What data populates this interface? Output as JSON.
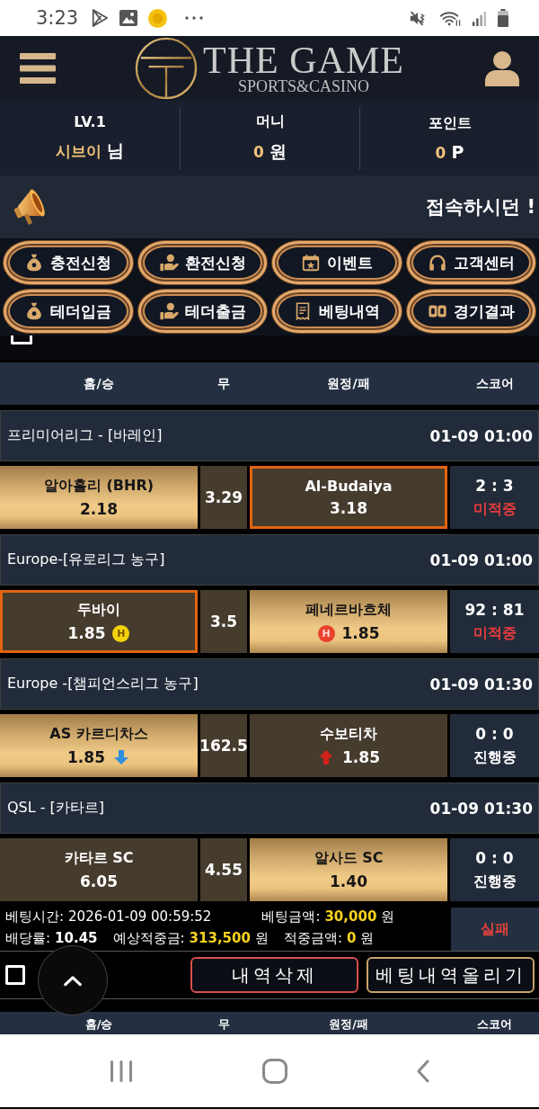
{
  "status_bar": {
    "time": "3:23"
  },
  "header": {
    "brand": "THE GAME",
    "tagline": "SPORTS&CASINO"
  },
  "user_info": [
    {
      "label": "LV.1",
      "value": "시브이",
      "unit": "님"
    },
    {
      "label": "머니",
      "value": "0",
      "unit": "원"
    },
    {
      "label": "포인트",
      "value": "0",
      "unit": "P"
    }
  ],
  "notice": {
    "text": "접속하시던 !"
  },
  "menu": [
    "충전신청",
    "환전신청",
    "이벤트",
    "고객센터",
    "테더입금",
    "테더출금",
    "베팅내역",
    "경기결과"
  ],
  "select_all": {
    "checked": false
  },
  "table": {
    "columns": [
      "홈/승",
      "무",
      "원정/패",
      "스코어"
    ],
    "matches": [
      {
        "league": "프리미어리그 - [바레인]",
        "time": "01-09 01:00",
        "home": {
          "name": "알아흘리 (BHR)",
          "odds": "2.18",
          "selected": true,
          "winner": false
        },
        "draw": "3.29",
        "away": {
          "name": "Al-Budaiya",
          "odds": "3.18",
          "selected": false,
          "winner": true
        },
        "score": "2 : 3",
        "status": {
          "text": "미적중",
          "kind": "miss"
        }
      },
      {
        "league": "Europe-[유로리그 농구]",
        "time": "01-09 01:00",
        "home": {
          "name": "두바이",
          "odds": "1.85",
          "selected": false,
          "winner": true,
          "marker": {
            "kind": "badge",
            "text": "H",
            "color": "#f5d20a"
          }
        },
        "draw": "3.5",
        "away": {
          "name": "페네르바흐체",
          "odds": "1.85",
          "selected": true,
          "winner": false,
          "marker": {
            "kind": "badge",
            "text": "H",
            "color": "#e8412c"
          }
        },
        "score": "92 : 81",
        "status": {
          "text": "미적중",
          "kind": "miss"
        }
      },
      {
        "league": "Europe -[챔피언스리그 농구]",
        "time": "01-09 01:30",
        "home": {
          "name": "AS 카르디차스",
          "odds": "1.85",
          "selected": true,
          "winner": false,
          "marker": {
            "kind": "down"
          }
        },
        "draw": "162.5",
        "away": {
          "name": "수보티차",
          "odds": "1.85",
          "selected": false,
          "winner": false,
          "marker": {
            "kind": "up"
          }
        },
        "score": "0 : 0",
        "status": {
          "text": "진행중",
          "kind": "live"
        }
      },
      {
        "league": "QSL - [카타르]",
        "time": "01-09 01:30",
        "home": {
          "name": "카타르 SC",
          "odds": "6.05",
          "selected": false,
          "winner": false
        },
        "draw": "4.55",
        "away": {
          "name": "알사드 SC",
          "odds": "1.40",
          "selected": true,
          "winner": false
        },
        "score": "0 : 0",
        "status": {
          "text": "진행중",
          "kind": "live"
        }
      }
    ]
  },
  "bet_summary": {
    "lines": [
      [
        {
          "label": "베팅시간:",
          "value": "2026-01-09 00:59:52",
          "kind": "plain"
        },
        {
          "label": "베팅금액:",
          "value": "30,000",
          "unit": "원",
          "kind": "amount"
        }
      ],
      [
        {
          "label": "배당률:",
          "value": "10.45",
          "kind": "bold"
        },
        {
          "label": "예상적중금:",
          "value": "313,500",
          "unit": "원",
          "kind": "amount"
        },
        {
          "label": "적중금액:",
          "value": "0",
          "unit": "원",
          "kind": "amount"
        }
      ]
    ],
    "result": {
      "text": "실패",
      "kind": "fail"
    }
  },
  "actions": {
    "checked": false,
    "buttons": [
      {
        "label": "내역삭제",
        "kind": "danger"
      },
      {
        "label": "베팅내역올리기",
        "kind": "primary"
      }
    ]
  },
  "next_table": {
    "columns": [
      "홈/승",
      "무",
      "원정/패",
      "스코어"
    ]
  }
}
